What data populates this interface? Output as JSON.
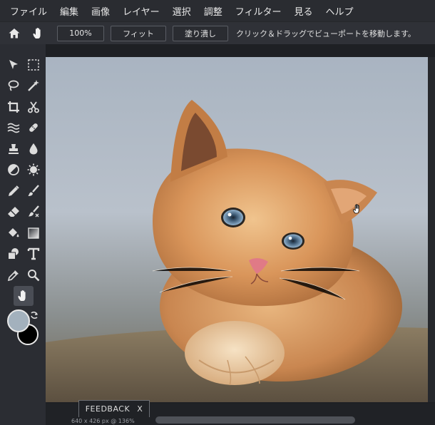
{
  "menu": [
    "ファイル",
    "編集",
    "画像",
    "レイヤー",
    "選択",
    "調整",
    "フィルター",
    "見る",
    "ヘルプ"
  ],
  "options": {
    "zoom_100": "100%",
    "fit": "フィット",
    "fill": "塗り潰し",
    "hint": "クリック＆ドラッグでビューポートを移動します。",
    "home_icon": "home-icon",
    "hand_icon": "hand-icon"
  },
  "colors": {
    "foreground": "#a3b1bd",
    "background": "#000000"
  },
  "feedback": {
    "label": "FEEDBACK",
    "close": "X"
  },
  "status": "640 x 426 px @ 136%",
  "tools": [
    "move",
    "marquee",
    "lasso",
    "magic-wand",
    "crop",
    "scissors",
    "liquify",
    "healing",
    "clone-stamp",
    "blur",
    "dodge",
    "sponge",
    "pencil",
    "brush",
    "eraser",
    "color-replace",
    "fill",
    "gradient",
    "shape",
    "text",
    "eyedropper",
    "zoom",
    "hand"
  ]
}
